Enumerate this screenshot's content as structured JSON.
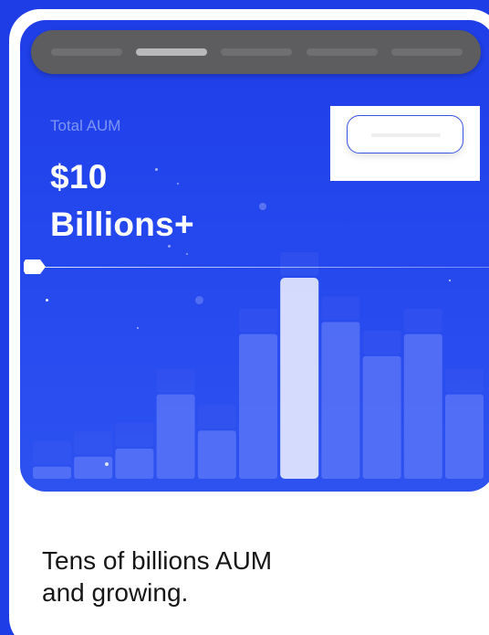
{
  "stat": {
    "label": "Total AUM",
    "value_line1": "$10",
    "value_line2": "Billions+"
  },
  "caption": {
    "line1": "Tens of billions AUM",
    "line2": "and growing."
  },
  "tabs": [
    {
      "active": false
    },
    {
      "active": true
    },
    {
      "active": false
    },
    {
      "active": false
    },
    {
      "active": false
    }
  ],
  "chart_data": {
    "type": "bar",
    "values": [
      0.06,
      0.11,
      0.15,
      0.42,
      0.24,
      0.72,
      1.0,
      0.78,
      0.61,
      0.72,
      0.42
    ],
    "highlight_index": 6,
    "colors": {
      "bar": "#5873f7",
      "bar_highlight": "#dde3fc",
      "bar_shadow": "#3655ee"
    }
  }
}
